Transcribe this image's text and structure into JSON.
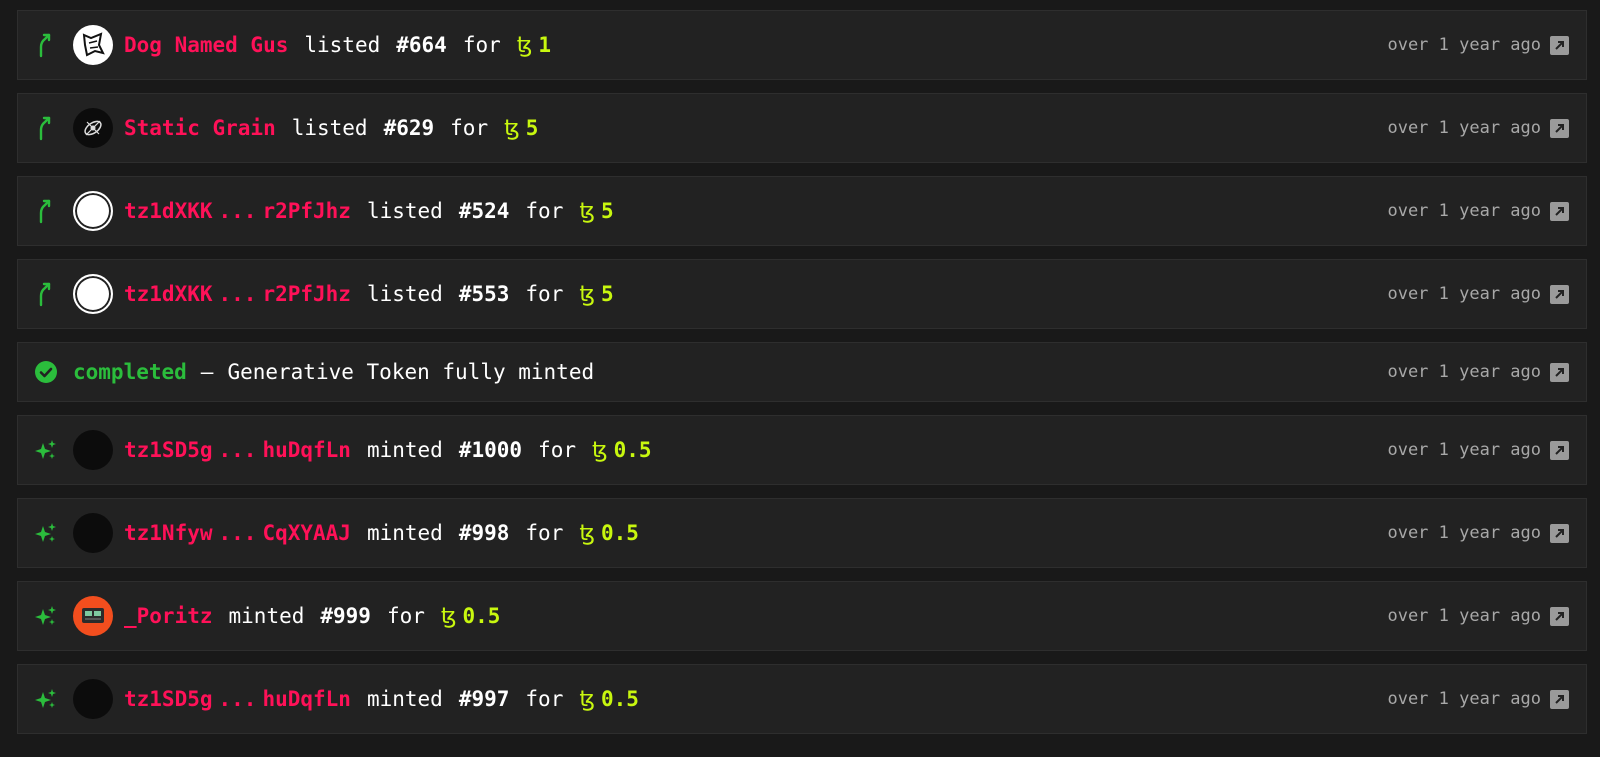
{
  "rows": [
    {
      "kind": "listed",
      "user": "Dog Named Gus",
      "verb": "listed",
      "token": "#664",
      "for": "for",
      "currency": "ꜩ",
      "price": "1",
      "time": "over 1 year ago"
    },
    {
      "kind": "listed",
      "user": "Static Grain",
      "verb": "listed",
      "token": "#629",
      "for": "for",
      "currency": "ꜩ",
      "price": "5",
      "time": "over 1 year ago"
    },
    {
      "kind": "listed",
      "user_start": "tz1dXKK",
      "user_sep": "...",
      "user_end": "r2PfJhz",
      "verb": "listed",
      "token": "#524",
      "for": "for",
      "currency": "ꜩ",
      "price": "5",
      "time": "over 1 year ago"
    },
    {
      "kind": "listed",
      "user_start": "tz1dXKK",
      "user_sep": "...",
      "user_end": "r2PfJhz",
      "verb": "listed",
      "token": "#553",
      "for": "for",
      "currency": "ꜩ",
      "price": "5",
      "time": "over 1 year ago"
    },
    {
      "kind": "completed",
      "status": "completed",
      "dash": "—",
      "message": "Generative Token fully minted",
      "time": "over 1 year ago"
    },
    {
      "kind": "minted",
      "user_start": "tz1SD5g",
      "user_sep": "...",
      "user_end": "huDqfLn",
      "verb": "minted",
      "token": "#1000",
      "for": "for",
      "currency": "ꜩ",
      "price": "0.5",
      "time": "over 1 year ago"
    },
    {
      "kind": "minted",
      "user_start": "tz1Nfyw",
      "user_sep": "...",
      "user_end": "CqXYAAJ",
      "verb": "minted",
      "token": "#998",
      "for": "for",
      "currency": "ꜩ",
      "price": "0.5",
      "time": "over 1 year ago"
    },
    {
      "kind": "minted",
      "user": "_Poritz",
      "verb": "minted",
      "token": "#999",
      "for": "for",
      "currency": "ꜩ",
      "price": "0.5",
      "time": "over 1 year ago"
    },
    {
      "kind": "minted",
      "user_start": "tz1SD5g",
      "user_sep": "...",
      "user_end": "huDqfLn",
      "verb": "minted",
      "token": "#997",
      "for": "for",
      "currency": "ꜩ",
      "price": "0.5",
      "time": "over 1 year ago"
    }
  ],
  "icons": {
    "listed": "arrow-up-icon",
    "minted": "sparkles-icon",
    "completed": "check-circle-icon",
    "link": "external-link-icon"
  },
  "colors": {
    "user": "#ff1158",
    "price": "#c8f70f",
    "green": "#2bbd3c",
    "background": "#191919",
    "row": "#222222"
  }
}
